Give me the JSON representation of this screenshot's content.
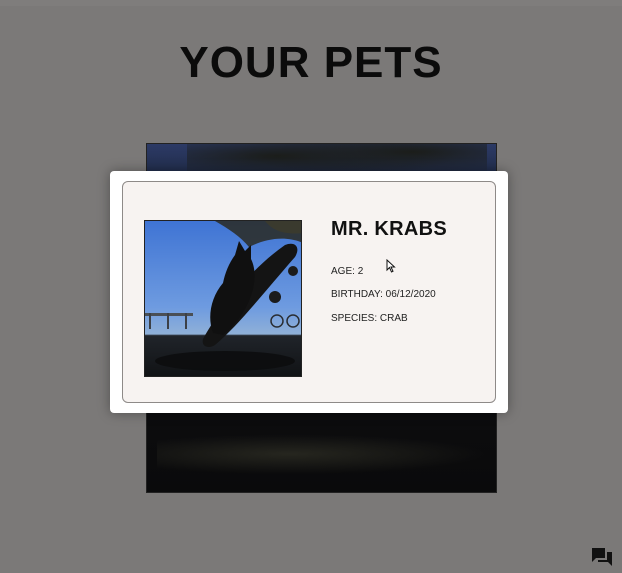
{
  "page": {
    "title": "YOUR PETS"
  },
  "pet": {
    "name": "MR. KRABS",
    "age_label": "AGE:",
    "age": "2",
    "birthday_label": "BIRTHDAY:",
    "birthday": "06/12/2020",
    "species_label": "SPECIES:",
    "species": "CRAB",
    "photo_icon": "cat-on-skateboard-photo"
  },
  "icons": {
    "chat": "chat-bubbles-icon",
    "cursor": "mouse-pointer-icon"
  },
  "colors": {
    "overlay_background": "#7b7978",
    "card_background": "#f7f3f1",
    "modal_background": "#ffffff",
    "title_text": "#0b0b0b"
  }
}
